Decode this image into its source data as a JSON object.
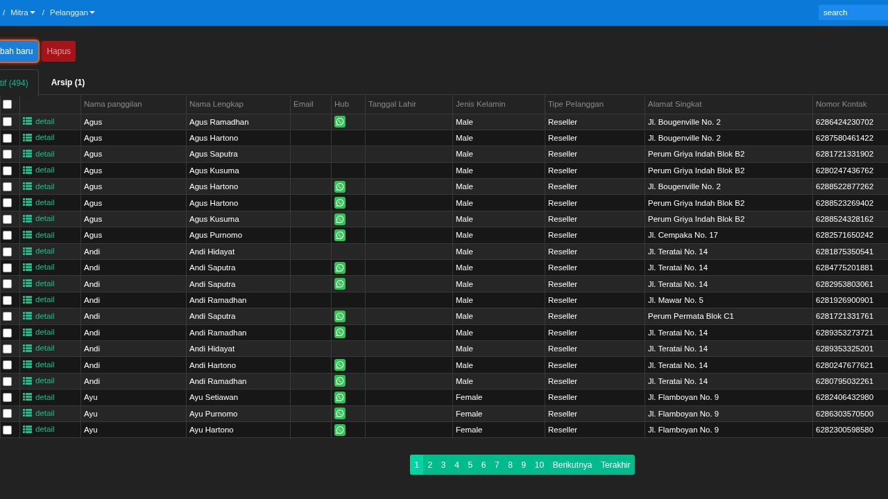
{
  "top_bar": {
    "breadcrumb": [
      {
        "separator": "/",
        "label": "Mitra",
        "dropdown": true
      },
      {
        "separator": "/",
        "label": "Pelanggan",
        "dropdown": true
      }
    ],
    "search": {
      "placeholder": "search"
    }
  },
  "actions": [
    {
      "label": "bah baru",
      "kind": "primary",
      "focused": true,
      "disabled": false
    },
    {
      "label": "Hapus",
      "kind": "danger",
      "focused": false,
      "disabled": true
    }
  ],
  "tabs": [
    {
      "label": "tif (494)",
      "selected": true
    },
    {
      "label": "Arsip (1)",
      "selected": false
    }
  ],
  "table": {
    "select_all": {
      "checked": false
    },
    "columns": [
      "Nama panggilan",
      "Nama Lengkap",
      "Email",
      "Hub",
      "Tanggal Lahir",
      "Jenis Kelamin",
      "Tipe Pelanggan",
      "Alamat Singkat",
      "Nomor Kontak"
    ],
    "rows": [
      {
        "checked": false,
        "link": "detail",
        "nama_panggilan": "Agus",
        "nama_lengkap": "Agus Ramadhan",
        "hub": true,
        "jenis_kelamin": "Male",
        "tipe_pelanggan": "Reseller",
        "alamat_singkat": "Jl. Bougenville No. 2",
        "nomor_kontak": "6286424230702"
      },
      {
        "checked": false,
        "link": "detail",
        "nama_panggilan": "Agus",
        "nama_lengkap": "Agus Hartono",
        "hub": false,
        "jenis_kelamin": "Male",
        "tipe_pelanggan": "Reseller",
        "alamat_singkat": "Jl. Bougenville No. 2",
        "nomor_kontak": "6287580461422"
      },
      {
        "checked": false,
        "link": "detail",
        "nama_panggilan": "Agus",
        "nama_lengkap": "Agus Saputra",
        "hub": false,
        "jenis_kelamin": "Male",
        "tipe_pelanggan": "Reseller",
        "alamat_singkat": "Perum Griya Indah Blok B2",
        "nomor_kontak": "6281721331902"
      },
      {
        "checked": false,
        "link": "detail",
        "nama_panggilan": "Agus",
        "nama_lengkap": "Agus Kusuma",
        "hub": false,
        "jenis_kelamin": "Male",
        "tipe_pelanggan": "Reseller",
        "alamat_singkat": "Perum Griya Indah Blok B2",
        "nomor_kontak": "6280247436762"
      },
      {
        "checked": false,
        "link": "detail",
        "nama_panggilan": "Agus",
        "nama_lengkap": "Agus Hartono",
        "hub": true,
        "jenis_kelamin": "Male",
        "tipe_pelanggan": "Reseller",
        "alamat_singkat": "Jl. Bougenville No. 2",
        "nomor_kontak": "6288522877262"
      },
      {
        "checked": false,
        "link": "detail",
        "nama_panggilan": "Agus",
        "nama_lengkap": "Agus Hartono",
        "hub": true,
        "jenis_kelamin": "Male",
        "tipe_pelanggan": "Reseller",
        "alamat_singkat": "Perum Griya Indah Blok B2",
        "nomor_kontak": "6288523269402"
      },
      {
        "checked": false,
        "link": "detail",
        "nama_panggilan": "Agus",
        "nama_lengkap": "Agus Kusuma",
        "hub": true,
        "jenis_kelamin": "Male",
        "tipe_pelanggan": "Reseller",
        "alamat_singkat": "Perum Griya Indah Blok B2",
        "nomor_kontak": "6288524328162"
      },
      {
        "checked": false,
        "link": "detail",
        "nama_panggilan": "Agus",
        "nama_lengkap": "Agus Purnomo",
        "hub": true,
        "jenis_kelamin": "Male",
        "tipe_pelanggan": "Reseller",
        "alamat_singkat": "Jl. Cempaka No. 17",
        "nomor_kontak": "6282571650242"
      },
      {
        "checked": false,
        "link": "detail",
        "nama_panggilan": "Andi",
        "nama_lengkap": "Andi Hidayat",
        "hub": false,
        "jenis_kelamin": "Male",
        "tipe_pelanggan": "Reseller",
        "alamat_singkat": "Jl. Teratai No. 14",
        "nomor_kontak": "6281875350541"
      },
      {
        "checked": false,
        "link": "detail",
        "nama_panggilan": "Andi",
        "nama_lengkap": "Andi Saputra",
        "hub": true,
        "jenis_kelamin": "Male",
        "tipe_pelanggan": "Reseller",
        "alamat_singkat": "Jl. Teratai No. 14",
        "nomor_kontak": "6284775201881"
      },
      {
        "checked": false,
        "link": "detail",
        "nama_panggilan": "Andi",
        "nama_lengkap": "Andi Saputra",
        "hub": true,
        "jenis_kelamin": "Male",
        "tipe_pelanggan": "Reseller",
        "alamat_singkat": "Jl. Teratai No. 14",
        "nomor_kontak": "6282953803061"
      },
      {
        "checked": false,
        "link": "detail",
        "nama_panggilan": "Andi",
        "nama_lengkap": "Andi Ramadhan",
        "hub": false,
        "jenis_kelamin": "Male",
        "tipe_pelanggan": "Reseller",
        "alamat_singkat": "Jl. Mawar No. 5",
        "nomor_kontak": "6281926900901"
      },
      {
        "checked": false,
        "link": "detail",
        "nama_panggilan": "Andi",
        "nama_lengkap": "Andi Saputra",
        "hub": true,
        "jenis_kelamin": "Male",
        "tipe_pelanggan": "Reseller",
        "alamat_singkat": "Perum Permata Blok C1",
        "nomor_kontak": "6281721331761"
      },
      {
        "checked": false,
        "link": "detail",
        "nama_panggilan": "Andi",
        "nama_lengkap": "Andi Ramadhan",
        "hub": true,
        "jenis_kelamin": "Male",
        "tipe_pelanggan": "Reseller",
        "alamat_singkat": "Jl. Teratai No. 14",
        "nomor_kontak": "6289353273721"
      },
      {
        "checked": false,
        "link": "detail",
        "nama_panggilan": "Andi",
        "nama_lengkap": "Andi Hidayat",
        "hub": false,
        "jenis_kelamin": "Male",
        "tipe_pelanggan": "Reseller",
        "alamat_singkat": "Jl. Teratai No. 14",
        "nomor_kontak": "6289353325201"
      },
      {
        "checked": false,
        "link": "detail",
        "nama_panggilan": "Andi",
        "nama_lengkap": "Andi Hartono",
        "hub": true,
        "jenis_kelamin": "Male",
        "tipe_pelanggan": "Reseller",
        "alamat_singkat": "Jl. Teratai No. 14",
        "nomor_kontak": "6280247677621"
      },
      {
        "checked": false,
        "link": "detail",
        "nama_panggilan": "Andi",
        "nama_lengkap": "Andi Ramadhan",
        "hub": true,
        "jenis_kelamin": "Male",
        "tipe_pelanggan": "Reseller",
        "alamat_singkat": "Jl. Teratai No. 14",
        "nomor_kontak": "6280795032261"
      },
      {
        "checked": false,
        "link": "detail",
        "nama_panggilan": "Ayu",
        "nama_lengkap": "Ayu Setiawan",
        "hub": true,
        "jenis_kelamin": "Female",
        "tipe_pelanggan": "Reseller",
        "alamat_singkat": "Jl. Flamboyan No. 9",
        "nomor_kontak": "6282406432980"
      },
      {
        "checked": false,
        "link": "detail",
        "nama_panggilan": "Ayu",
        "nama_lengkap": "Ayu Purnomo",
        "hub": true,
        "jenis_kelamin": "Female",
        "tipe_pelanggan": "Reseller",
        "alamat_singkat": "Jl. Flamboyan No. 9",
        "nomor_kontak": "6286303570500"
      },
      {
        "checked": false,
        "link": "detail",
        "nama_panggilan": "Ayu",
        "nama_lengkap": "Ayu Hartono",
        "hub": true,
        "jenis_kelamin": "Female",
        "tipe_pelanggan": "Reseller",
        "alamat_singkat": "Jl. Flamboyan No. 9",
        "nomor_kontak": "6282300598580"
      }
    ]
  },
  "pagination": {
    "pages": [
      {
        "label": "1",
        "selected": true
      },
      {
        "label": "2",
        "selected": false
      },
      {
        "label": "3",
        "selected": false
      },
      {
        "label": "4",
        "selected": false
      },
      {
        "label": "5",
        "selected": false
      },
      {
        "label": "6",
        "selected": false
      },
      {
        "label": "7",
        "selected": false
      },
      {
        "label": "8",
        "selected": false
      },
      {
        "label": "9",
        "selected": false
      },
      {
        "label": "10",
        "selected": false
      }
    ],
    "next": "Berikutnya",
    "last": "Terakhir"
  }
}
